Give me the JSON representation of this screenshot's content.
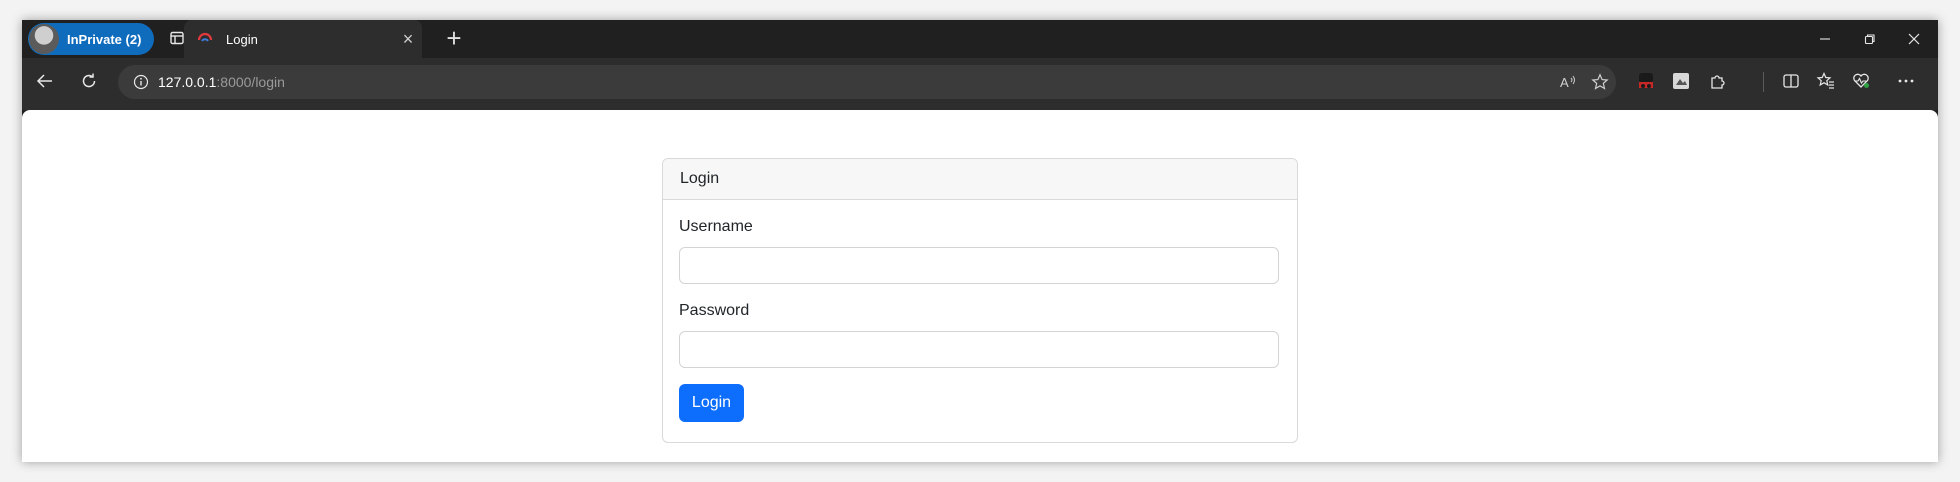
{
  "browser": {
    "profile_label": "InPrivate (2)",
    "tab_title": "Login",
    "tab_close": "×",
    "new_tab": "+",
    "url_host": "127.0.0.1",
    "url_rest": ":8000/login",
    "read_aloud_label": "Aʾ"
  },
  "form": {
    "header": "Login",
    "username_label": "Username",
    "username_value": "",
    "password_label": "Password",
    "password_value": "",
    "submit_label": "Login"
  },
  "colors": {
    "primary": "#0d6efd",
    "profile_badge": "#0f6cbd"
  },
  "icons": [
    "workspaces-icon",
    "edge-tab-icon",
    "back-icon",
    "refresh-icon",
    "info-icon",
    "read-aloud-icon",
    "favorite-star-icon",
    "extension-icon-1",
    "extension-icon-2",
    "extensions-puzzle-icon",
    "split-screen-icon",
    "favorites-icon",
    "browser-essentials-icon",
    "more-menu-icon",
    "minimize-icon",
    "restore-icon",
    "close-window-icon"
  ]
}
